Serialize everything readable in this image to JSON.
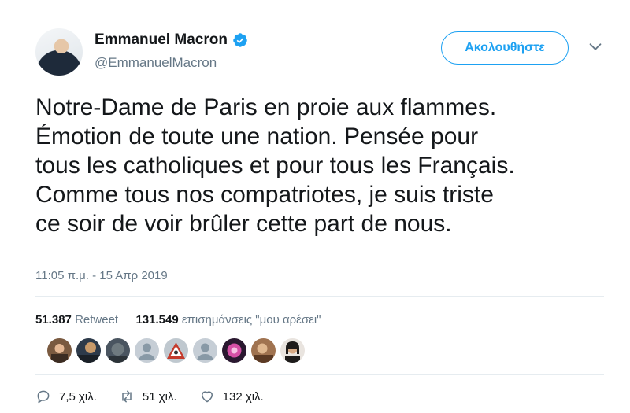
{
  "author": {
    "name": "Emmanuel Macron",
    "handle": "@EmmanuelMacron",
    "verified": true
  },
  "follow_button": {
    "label": "Ακολουθήστε"
  },
  "tweet": {
    "text": "Notre-Dame de Paris en proie aux flammes.\nÉmotion de toute une nation. Pensée pour\ntous les catholiques et pour tous les Français.\nComme tous nos compatriotes, je suis triste\nce soir de voir brûler cette part de nous.",
    "timestamp": "11:05 π.μ. - 15 Απρ 2019"
  },
  "stats": {
    "retweets_count": "51.387",
    "retweets_label": "Retweet",
    "likes_count": "131.549",
    "likes_label": "επισημάνσεις \"μου αρέσει\""
  },
  "actions": {
    "replies": "7,5 χιλ.",
    "retweets": "51 χιλ.",
    "likes": "132 χιλ."
  },
  "colors": {
    "accent": "#1da1f2",
    "text": "#14171a",
    "secondary": "#657786"
  }
}
